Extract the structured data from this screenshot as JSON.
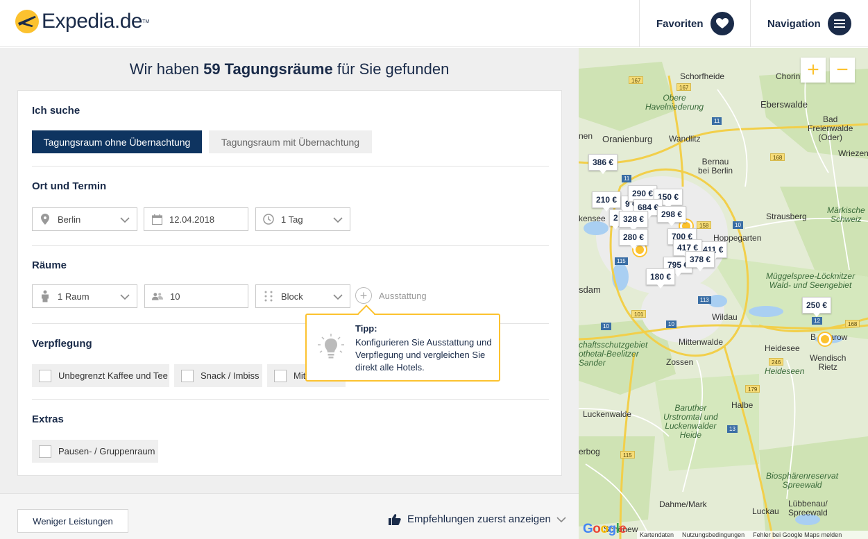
{
  "header": {
    "logo_text": "Expedia.de",
    "logo_tm": "TM",
    "favorites_label": "Favoriten",
    "navigation_label": "Navigation"
  },
  "results": {
    "prefix": "Wir haben ",
    "count_label": "59 Tagungsräume",
    "suffix": " für Sie gefunden"
  },
  "search": {
    "section_label": "Ich suche",
    "tab_active": "Tagungsraum ohne Übernachtung",
    "tab_inactive": "Tagungsraum mit Übernachtung"
  },
  "location": {
    "section_label": "Ort und Termin",
    "city": "Berlin",
    "date": "12.04.2018",
    "duration": "1 Tag"
  },
  "rooms": {
    "section_label": "Räume",
    "room_count": "1 Raum",
    "persons": "10",
    "seating": "Block",
    "equipment_label": "Ausstattung"
  },
  "tip": {
    "title": "Tipp:",
    "text": "Konfigurieren Sie Ausstattung und Verpflegung und vergleichen Sie direkt alle Hotels."
  },
  "catering": {
    "section_label": "Verpflegung",
    "options": [
      "Unbegrenzt Kaffee und Tee",
      "Snack / Imbiss",
      "Mit"
    ]
  },
  "extras": {
    "section_label": "Extras",
    "options": [
      "Pausen- / Gruppenraum"
    ]
  },
  "footer": {
    "less_services": "Weniger Leistungen",
    "sort_label": "Empfehlungen zuerst anzeigen"
  },
  "map": {
    "zoom_in": "+",
    "zoom_out": "−",
    "places": {
      "schorfheide": "Schorfheide",
      "chorin": "Chorin",
      "obere_havelniederung": "Obere\nHavelniederung",
      "eberswalde": "Eberswalde",
      "bad_freienwalde": "Bad\nFreienwalde\n(Oder)",
      "oranienburg": "Oranienburg",
      "wandlitz": "Wandlitz",
      "bernau": "Bernau\nbei Berlin",
      "wriezen": "Wriezen",
      "maerkische_schweiz": "Märkische\nSchweiz",
      "strausberg": "Strausberg",
      "hoppegarten": "Hoppegarten",
      "kensee": "kensee",
      "nen": "nen",
      "muggelspree": "Müggelspree-Löcknitzer\nWald- und Seengebiet",
      "sdam": "sdam",
      "wildau": "Wildau",
      "mittenwalde": "Mittenwalde",
      "heidesee": "Heidesee",
      "wendisch_rietz": "Wendisch\nRietz",
      "bsarow": "B    sarow",
      "zossen": "Zossen",
      "schaftsschutzgebiet": "chaftsschutzgebiet\nothetal-Beelitzer\nSander",
      "heideseen": "Heideseen",
      "halbe": "Halbe",
      "baruther": "Baruther\nUrstromtal und\nLuckenwalder\nHeide",
      "luckenwalde": "Luckenwalde",
      "erbog": "erbog",
      "biosphaere": "Biosphärenreservat\nSpreewald",
      "luebbenau": "Lübbenau/\nSpreewald",
      "dahme": "Dahme/Mark",
      "luckau": "Luckau",
      "schoenew": "Schönew"
    },
    "roads": [
      "167",
      "167",
      "11",
      "11",
      "109",
      "111",
      "96",
      "158",
      "1",
      "168",
      "10",
      "5",
      "115",
      "101",
      "10",
      "10",
      "113",
      "12",
      "168",
      "179",
      "246",
      "13",
      "115",
      "96",
      "13"
    ],
    "prices": [
      "386 €",
      "210 €",
      "290 €",
      "150 €",
      "684 €",
      "298 €",
      "328 €",
      "280 €",
      "700 €",
      "417 €",
      "411 €",
      "795 €",
      "378 €",
      "180 €",
      "250 €",
      "9 €",
      "2"
    ],
    "footer_items": [
      "Kartendaten",
      "Nutzungsbedingungen",
      "Fehler bei Google Maps melden"
    ],
    "google": "Google"
  }
}
